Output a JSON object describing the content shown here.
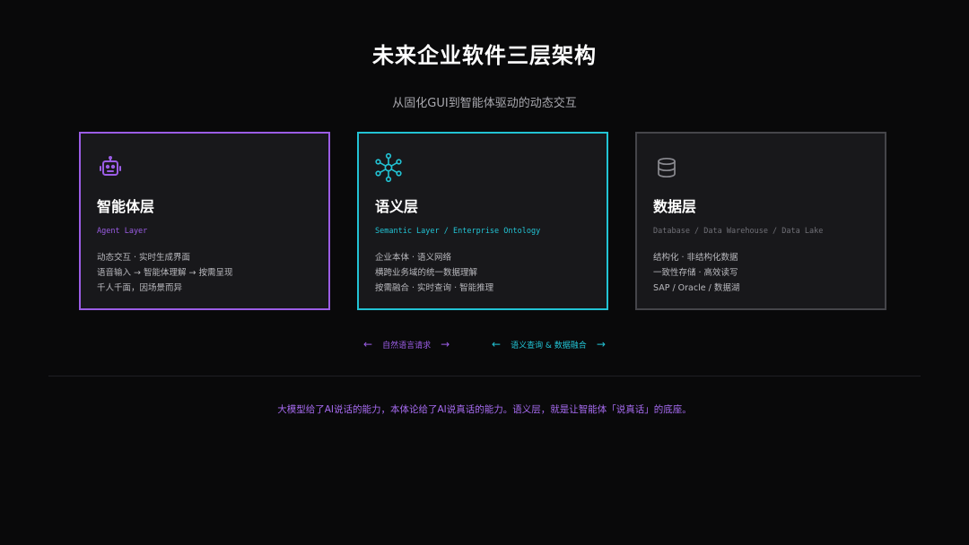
{
  "page": {
    "title": "未来企业软件三层架构",
    "subtitle": "从固化GUI到智能体驱动的动态交互"
  },
  "colors": {
    "background": "#09090a",
    "card_background": "#18181b",
    "agent_accent": "#9b5de5",
    "semantic_accent": "#22c3d4",
    "data_border": "#45454a",
    "quote_text": "#a66bf0"
  },
  "layers": [
    {
      "icon": "robot-icon",
      "name": "智能体层",
      "english": "Agent Layer",
      "lines": [
        "动态交互 · 实时生成界面",
        "语音输入 → 智能体理解 → 按需呈现",
        "千人千面，因场景而异"
      ]
    },
    {
      "icon": "network-icon",
      "name": "语义层",
      "english": "Semantic Layer / Enterprise Ontology",
      "lines": [
        "企业本体 · 语义网络",
        "横跨业务域的统一数据理解",
        "按需融合 · 实时查询 · 智能推理"
      ]
    },
    {
      "icon": "database-icon",
      "name": "数据层",
      "english": "Database / Data Warehouse / Data Lake",
      "lines": [
        "结构化 · 非结构化数据",
        "一致性存储 · 高效读写",
        "SAP / Oracle / 数据湖"
      ]
    }
  ],
  "flows": [
    {
      "left_arrow": "←",
      "label": "自然语言请求",
      "right_arrow": "→"
    },
    {
      "left_arrow": "←",
      "label": "语义查询 & 数据融合",
      "right_arrow": "→"
    }
  ],
  "footer": {
    "quote": "大模型给了AI说话的能力，本体论给了AI说真话的能力。语义层，就是让智能体「说真话」的底座。"
  }
}
